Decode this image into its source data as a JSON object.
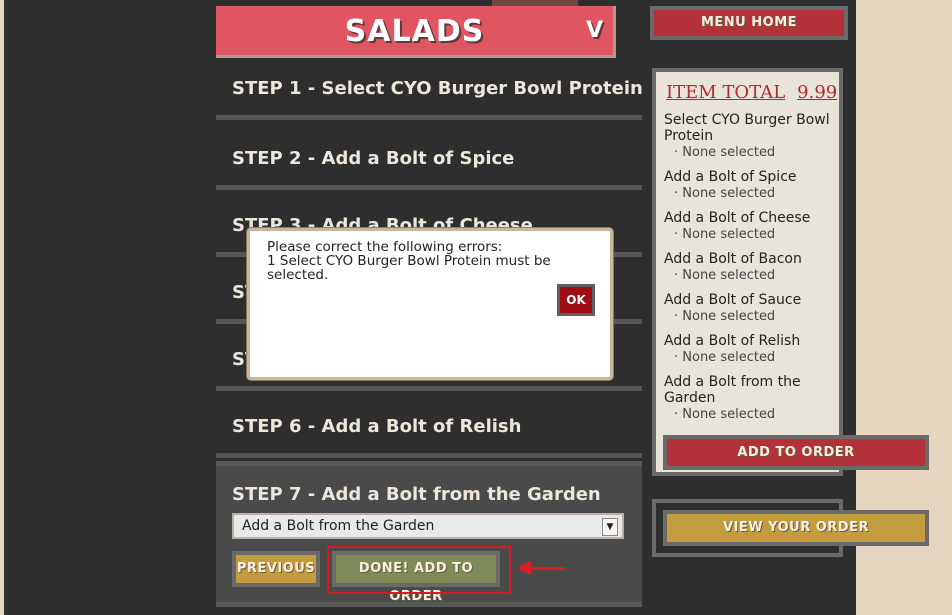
{
  "category": {
    "title": "SALADS",
    "toggle": "V"
  },
  "steps": [
    {
      "label": "STEP 1 - Select CYO Burger Bowl Protein"
    },
    {
      "label": "STEP 2 - Add a Bolt of Spice"
    },
    {
      "label": "STEP 3 - Add a Bolt of Cheese"
    },
    {
      "label": "ST"
    },
    {
      "label": "ST"
    },
    {
      "label": "STEP 6 - Add a Bolt of Relish"
    },
    {
      "label": "STEP 7 - Add a Bolt from the Garden"
    }
  ],
  "garden_select": {
    "value": "Add a Bolt from the Garden"
  },
  "buttons": {
    "previous": "PREVIOUS",
    "done": "DONE! ADD TO ORDER",
    "menu_home": "MENU HOME",
    "add_to_order": "ADD TO ORDER",
    "view_order": "VIEW YOUR ORDER"
  },
  "summary": {
    "total_label": "ITEM TOTAL",
    "total_amount": "9.99",
    "items": [
      {
        "name": "Select CYO Burger Bowl Protein",
        "value": "· None selected"
      },
      {
        "name": "Add a Bolt of Spice",
        "value": "· None selected"
      },
      {
        "name": "Add a Bolt of Cheese",
        "value": "· None selected"
      },
      {
        "name": "Add a Bolt of Bacon",
        "value": "· None selected"
      },
      {
        "name": "Add a Bolt of Sauce",
        "value": "· None selected"
      },
      {
        "name": "Add a Bolt of Relish",
        "value": "· None selected"
      },
      {
        "name": "Add a Bolt from the Garden",
        "value": "· None selected"
      }
    ]
  },
  "dialog": {
    "line1": "Please correct the following errors:",
    "line2": "1 Select CYO Burger Bowl Protein must be selected.",
    "ok": "OK"
  },
  "colors": {
    "header": "#e05561",
    "accent_red": "#b3323a",
    "accent_gold": "#c49c3e",
    "done_green": "#7e8a58",
    "annotation_red": "#d71921"
  }
}
